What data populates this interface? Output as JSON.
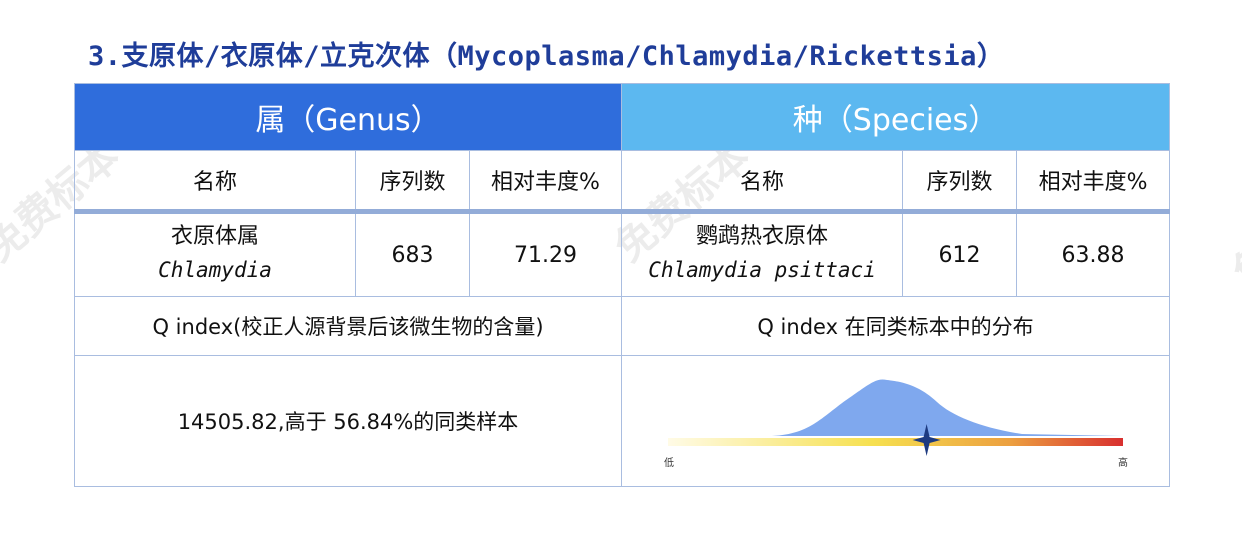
{
  "section_title": "3.支原体/衣原体/立克次体（Mycoplasma/Chlamydia/Rickettsia）",
  "watermark": "免费标本",
  "genus_header": "属（Genus）",
  "species_header": "种（Species）",
  "columns": {
    "name": "名称",
    "reads": "序列数",
    "abundance": "相对丰度%"
  },
  "genus": {
    "name_cn": "衣原体属",
    "name_latin": "Chlamydia",
    "reads": "683",
    "abundance": "71.29"
  },
  "species": {
    "name_cn": "鹦鹉热衣原体",
    "name_latin": "Chlamydia psittaci",
    "reads": "612",
    "abundance": "63.88"
  },
  "q_index_label": "Q index(校正人源背景后该微生物的含量)",
  "q_distribution_label": "Q index 在同类标本中的分布",
  "q_index_value": "14505.82,高于 56.84%的同类样本",
  "percentile": 56.84,
  "scale_low": "低",
  "scale_high": "高",
  "colors": {
    "title": "#1f3d99",
    "genus_header": "#2f6ddc",
    "species_header": "#5cb8f0",
    "distribution_fill": "#7fa8ee",
    "marker": "#1d3a80"
  }
}
